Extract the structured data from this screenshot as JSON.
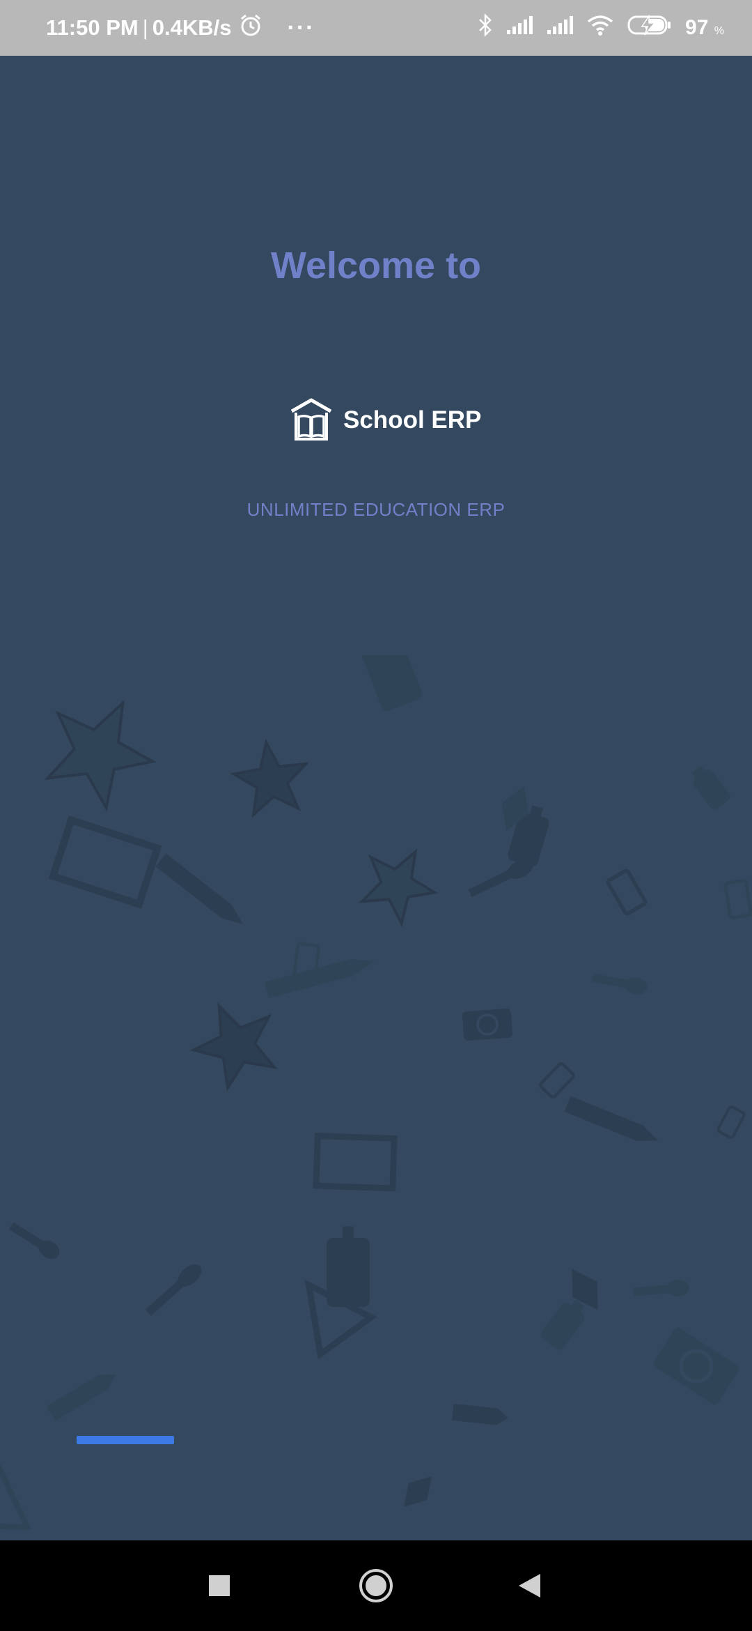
{
  "status_bar": {
    "time": "11:50 PM",
    "separator": "|",
    "network_speed": "0.4KB/s",
    "more_indicator": "···",
    "battery_percent": "97",
    "battery_unit": "%",
    "icons": [
      "alarm-icon",
      "bluetooth-icon",
      "signal-icon",
      "signal-icon",
      "wifi-icon",
      "battery-charging-icon"
    ]
  },
  "splash": {
    "welcome_text": "Welcome to",
    "logo_text": "School ERP",
    "tagline": "UNLIMITED EDUCATION ERP",
    "progress_fraction": 0.0
  },
  "nav_bar": {
    "buttons": [
      "recents-button",
      "home-button",
      "back-button"
    ]
  },
  "colors": {
    "background": "#34495f",
    "accent_text": "#7081c9",
    "progress": "#3d7ae6",
    "status_bar": "#b8b8b8",
    "nav_bar": "#000000"
  }
}
